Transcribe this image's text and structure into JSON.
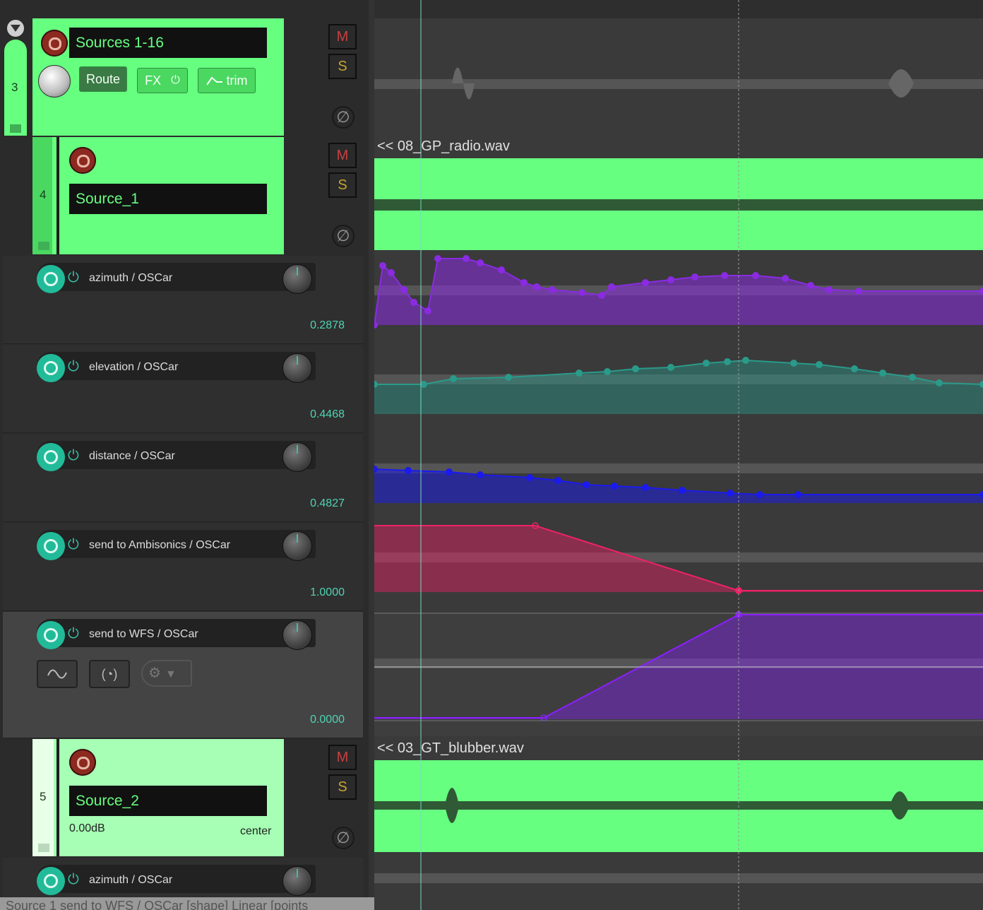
{
  "tracks": {
    "folder": {
      "number": "3",
      "name": "Sources 1-16",
      "route_label": "Route",
      "fx_label": "FX",
      "trim_label": "trim",
      "mute": "M",
      "solo": "S"
    },
    "source1": {
      "number": "4",
      "name": "Source_1",
      "mute": "M",
      "solo": "S"
    },
    "source2": {
      "number": "5",
      "name": "Source_2",
      "volume": "0.00dB",
      "pan": "center",
      "mute": "M",
      "solo": "S"
    }
  },
  "envelopes": [
    {
      "label": "azimuth / OSCar",
      "value": "0.2878",
      "color": "#8a2be2"
    },
    {
      "label": "elevation / OSCar",
      "value": "0.4468",
      "color": "#2a9a8a"
    },
    {
      "label": "distance / OSCar",
      "value": "0.4827",
      "color": "#1a1aee"
    },
    {
      "label": "send to Ambisonics / OSCar",
      "value": "1.0000",
      "color": "#ee2266"
    },
    {
      "label": "send to WFS / OSCar",
      "value": "0.0000",
      "color": "#8a1fff"
    }
  ],
  "envelope_next": {
    "label": "azimuth / OSCar"
  },
  "items": {
    "source1_item": "<< 08_GP_radio.wav",
    "source2_item": "<< 03_GT_blubber.wav"
  },
  "status_bar": "Source 1 send to WFS / OSCar [shape] Linear [points"
}
